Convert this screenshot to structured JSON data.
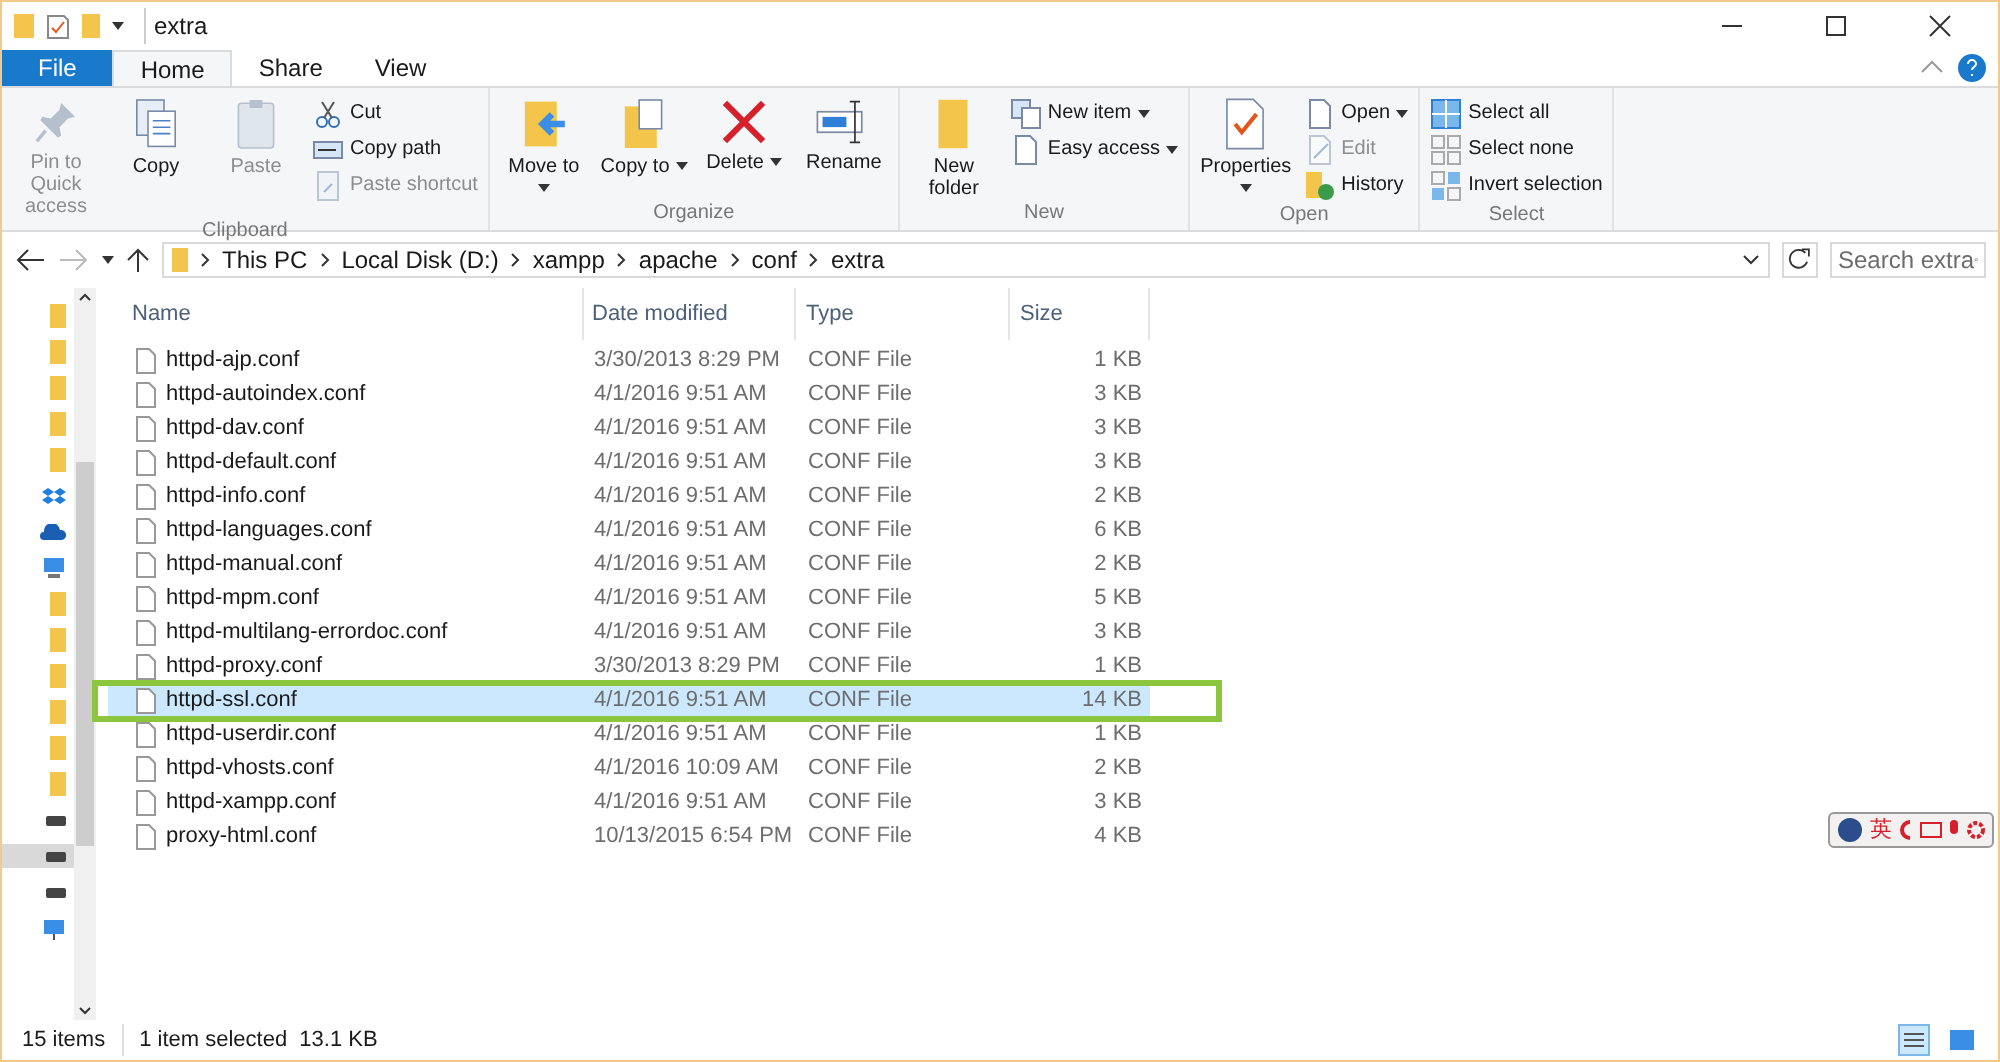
{
  "window": {
    "title": "extra"
  },
  "ribbon_tabs": [
    {
      "label": "File",
      "kind": "file",
      "selected": false
    },
    {
      "label": "Home",
      "kind": "tab",
      "selected": true
    },
    {
      "label": "Share",
      "kind": "tab",
      "selected": false
    },
    {
      "label": "View",
      "kind": "tab",
      "selected": false
    }
  ],
  "ribbon_groups": [
    {
      "title": "Clipboard",
      "items": [
        {
          "kind": "pin",
          "label": "Pin to Quick access",
          "disabled": true,
          "dropdown": false
        },
        {
          "kind": "copy",
          "label": "Copy",
          "disabled": false,
          "dropdown": false
        },
        {
          "kind": "paste",
          "label": "Paste",
          "disabled": true,
          "dropdown": false
        },
        {
          "kind": "stack",
          "items": [
            {
              "kind": "cut",
              "label": "Cut",
              "disabled": false,
              "dropdown": false
            },
            {
              "kind": "copypath",
              "label": "Copy path",
              "disabled": false,
              "dropdown": false
            },
            {
              "kind": "shortcut",
              "label": "Paste shortcut",
              "disabled": true,
              "dropdown": false
            }
          ]
        }
      ]
    },
    {
      "title": "Organize",
      "items": [
        {
          "kind": "move",
          "label": "Move to",
          "disabled": false,
          "dropdown": true
        },
        {
          "kind": "copyto",
          "label": "Copy to",
          "disabled": false,
          "dropdown": true
        },
        {
          "kind": "delete",
          "label": "Delete",
          "disabled": false,
          "dropdown": true
        },
        {
          "kind": "rename",
          "label": "Rename",
          "disabled": false,
          "dropdown": false
        }
      ]
    },
    {
      "title": "New",
      "items": [
        {
          "kind": "folder",
          "label": "New folder",
          "disabled": false,
          "dropdown": false
        },
        {
          "kind": "stack",
          "items": [
            {
              "kind": "newitem",
              "label": "New item",
              "disabled": false,
              "dropdown": true
            },
            {
              "kind": "easy",
              "label": "Easy access",
              "disabled": false,
              "dropdown": true
            }
          ]
        }
      ]
    },
    {
      "title": "Open",
      "items": [
        {
          "kind": "properties",
          "label": "Properties",
          "disabled": false,
          "dropdown": true
        },
        {
          "kind": "stack",
          "items": [
            {
              "kind": "open",
              "label": "Open",
              "disabled": false,
              "dropdown": true
            },
            {
              "kind": "edit",
              "label": "Edit",
              "disabled": true,
              "dropdown": false
            },
            {
              "kind": "history",
              "label": "History",
              "disabled": false,
              "dropdown": false
            }
          ]
        }
      ]
    },
    {
      "title": "Select",
      "items": [
        {
          "kind": "stack",
          "items": [
            {
              "kind": "selall",
              "label": "Select all",
              "disabled": false,
              "dropdown": false
            },
            {
              "kind": "selnone",
              "label": "Select none",
              "disabled": false,
              "dropdown": false
            },
            {
              "kind": "invert",
              "label": "Invert selection",
              "disabled": false,
              "dropdown": false
            }
          ]
        }
      ]
    }
  ],
  "address": {
    "path": [
      "This PC",
      "Local Disk (D:)",
      "xampp",
      "apache",
      "conf",
      "extra"
    ],
    "search_placeholder": "Search extra"
  },
  "nav": [
    {
      "kind": "folder",
      "selected": false
    },
    {
      "kind": "folder",
      "selected": false
    },
    {
      "kind": "folder",
      "selected": false
    },
    {
      "kind": "folder",
      "selected": false
    },
    {
      "kind": "folder",
      "selected": false
    },
    {
      "kind": "dropbox",
      "selected": false
    },
    {
      "kind": "cloud",
      "selected": false
    },
    {
      "kind": "pc",
      "selected": false
    },
    {
      "kind": "folder",
      "selected": false
    },
    {
      "kind": "folder",
      "selected": false
    },
    {
      "kind": "folder",
      "selected": false
    },
    {
      "kind": "folder",
      "selected": false
    },
    {
      "kind": "folder",
      "selected": false
    },
    {
      "kind": "folder",
      "selected": false
    },
    {
      "kind": "drive",
      "selected": false
    },
    {
      "kind": "drive",
      "selected": true
    },
    {
      "kind": "drive",
      "selected": false
    },
    {
      "kind": "network",
      "selected": false
    }
  ],
  "table": {
    "columns": [
      "Name",
      "Date modified",
      "Type",
      "Size"
    ],
    "rows": [
      {
        "name": "httpd-ajp.conf",
        "date": "3/30/2013 8:29 PM",
        "type": "CONF File",
        "size": "1 KB",
        "selected": false,
        "highlighted": false
      },
      {
        "name": "httpd-autoindex.conf",
        "date": "4/1/2016 9:51 AM",
        "type": "CONF File",
        "size": "3 KB",
        "selected": false,
        "highlighted": false
      },
      {
        "name": "httpd-dav.conf",
        "date": "4/1/2016 9:51 AM",
        "type": "CONF File",
        "size": "3 KB",
        "selected": false,
        "highlighted": false
      },
      {
        "name": "httpd-default.conf",
        "date": "4/1/2016 9:51 AM",
        "type": "CONF File",
        "size": "3 KB",
        "selected": false,
        "highlighted": false
      },
      {
        "name": "httpd-info.conf",
        "date": "4/1/2016 9:51 AM",
        "type": "CONF File",
        "size": "2 KB",
        "selected": false,
        "highlighted": false
      },
      {
        "name": "httpd-languages.conf",
        "date": "4/1/2016 9:51 AM",
        "type": "CONF File",
        "size": "6 KB",
        "selected": false,
        "highlighted": false
      },
      {
        "name": "httpd-manual.conf",
        "date": "4/1/2016 9:51 AM",
        "type": "CONF File",
        "size": "2 KB",
        "selected": false,
        "highlighted": false
      },
      {
        "name": "httpd-mpm.conf",
        "date": "4/1/2016 9:51 AM",
        "type": "CONF File",
        "size": "5 KB",
        "selected": false,
        "highlighted": false
      },
      {
        "name": "httpd-multilang-errordoc.conf",
        "date": "4/1/2016 9:51 AM",
        "type": "CONF File",
        "size": "3 KB",
        "selected": false,
        "highlighted": false
      },
      {
        "name": "httpd-proxy.conf",
        "date": "3/30/2013 8:29 PM",
        "type": "CONF File",
        "size": "1 KB",
        "selected": false,
        "highlighted": false
      },
      {
        "name": "httpd-ssl.conf",
        "date": "4/1/2016 9:51 AM",
        "type": "CONF File",
        "size": "14 KB",
        "selected": true,
        "highlighted": true
      },
      {
        "name": "httpd-userdir.conf",
        "date": "4/1/2016 9:51 AM",
        "type": "CONF File",
        "size": "1 KB",
        "selected": false,
        "highlighted": false
      },
      {
        "name": "httpd-vhosts.conf",
        "date": "4/1/2016 10:09 AM",
        "type": "CONF File",
        "size": "2 KB",
        "selected": false,
        "highlighted": false
      },
      {
        "name": "httpd-xampp.conf",
        "date": "4/1/2016 9:51 AM",
        "type": "CONF File",
        "size": "3 KB",
        "selected": false,
        "highlighted": false
      },
      {
        "name": "proxy-html.conf",
        "date": "10/13/2015 6:54 PM",
        "type": "CONF File",
        "size": "4 KB",
        "selected": false,
        "highlighted": false
      }
    ]
  },
  "ime_toolbar": {
    "label": "英"
  },
  "status_bar": {
    "count": "15 items",
    "selection": "1 item selected  13.1 KB"
  }
}
